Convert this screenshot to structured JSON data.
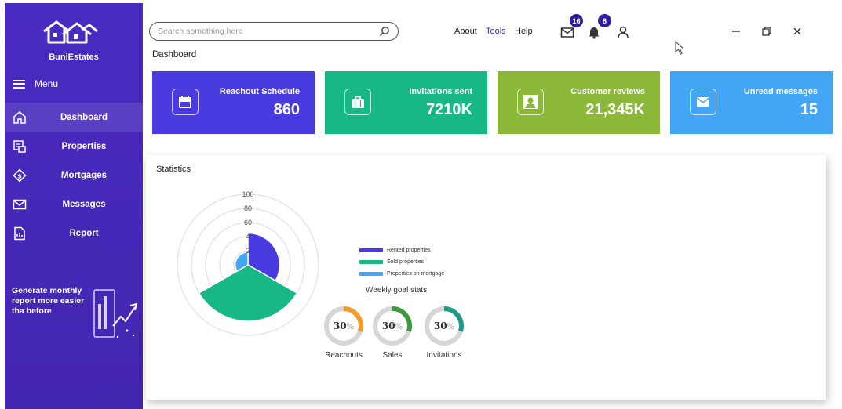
{
  "brand": {
    "name": "BuniEstates"
  },
  "sidebar": {
    "menu_label": "Menu",
    "items": [
      {
        "label": "Dashboard",
        "icon": "home-icon",
        "active": true
      },
      {
        "label": "Properties",
        "icon": "properties-icon"
      },
      {
        "label": "Mortgages",
        "icon": "mortgage-icon"
      },
      {
        "label": "Messages",
        "icon": "mail-icon"
      },
      {
        "label": "Report",
        "icon": "report-icon"
      }
    ],
    "promo_text": "Generate monthly report more easier tha   before"
  },
  "header": {
    "search_placeholder": "Search something here",
    "nav": [
      "About",
      "Tools",
      "Help"
    ],
    "active_nav": "Tools",
    "mail_badge": "16",
    "notif_badge": "8"
  },
  "page_title": "Dashboard",
  "cards": [
    {
      "title": "Reachout Schedule",
      "value": "860",
      "icon": "calendar-icon",
      "color": "#4a3be0"
    },
    {
      "title": "Invitations sent",
      "value": "7210K",
      "icon": "briefcase-icon",
      "color": "#17b886"
    },
    {
      "title": "Customer reviews",
      "value": "21,345K",
      "icon": "user-icon",
      "color": "#8cb83a"
    },
    {
      "title": "Unread messages",
      "value": "15",
      "icon": "envelope-icon",
      "color": "#42a5f5"
    }
  ],
  "statistics": {
    "title": "Statistics",
    "legend": [
      {
        "name": "Rented properties",
        "color": "#4a3be0"
      },
      {
        "name": "Sold properties",
        "color": "#17b886"
      },
      {
        "name": "Properties on mortgage",
        "color": "#42a5f5"
      }
    ]
  },
  "chart_data": {
    "type": "polar-area",
    "axis_ticks": [
      "100",
      "80",
      "60",
      "4",
      "2"
    ],
    "rmax": 100,
    "series": [
      {
        "name": "Rented properties",
        "value": 45,
        "color": "#4a3be0"
      },
      {
        "name": "Sold properties",
        "value": 80,
        "color": "#17b886"
      },
      {
        "name": "Properties on mortgage",
        "value": 18,
        "color": "#42a5f5"
      }
    ]
  },
  "weekly_goals": {
    "title": "Weekly goal stats",
    "items": [
      {
        "label": "Reachouts",
        "value": "30",
        "unit": "%",
        "percent": 30,
        "color": "#f39c2a"
      },
      {
        "label": "Sales",
        "value": "30",
        "unit": "%",
        "percent": 30,
        "color": "#3a9a3e"
      },
      {
        "label": "Invitations",
        "value": "30",
        "unit": "%",
        "percent": 30,
        "color": "#1f9a8a"
      }
    ]
  }
}
